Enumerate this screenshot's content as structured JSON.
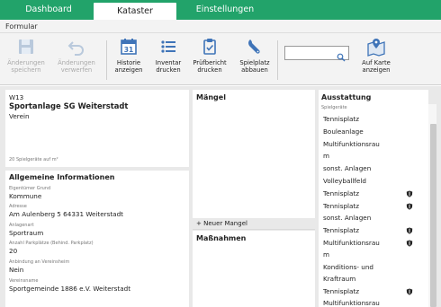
{
  "tabs": [
    {
      "label": "Dashboard",
      "active": false
    },
    {
      "label": "Kataster",
      "active": true
    },
    {
      "label": "Einstellungen",
      "active": false
    }
  ],
  "ribbon": {
    "group_label": "Formular",
    "buttons": {
      "save": {
        "line1": "Änderungen",
        "line2": "speichern",
        "icon": "save-icon",
        "enabled": false
      },
      "discard": {
        "line1": "Änderungen",
        "line2": "verwerfen",
        "icon": "undo-icon",
        "enabled": false
      },
      "history": {
        "line1": "Historie",
        "line2": "anzeigen",
        "icon": "calendar-icon",
        "enabled": true,
        "calendar_day": "31"
      },
      "inventory": {
        "line1": "Inventar",
        "line2": "drucken",
        "icon": "list-icon",
        "enabled": true
      },
      "report": {
        "line1": "Prüfbericht",
        "line2": "drucken",
        "icon": "clipboard-check-icon",
        "enabled": true
      },
      "dismantle": {
        "line1": "Spielplatz",
        "line2": "abbauen",
        "icon": "wrench-icon",
        "enabled": true
      },
      "map": {
        "line1": "Auf Karte",
        "line2": "anzeigen",
        "icon": "map-icon",
        "enabled": true
      }
    },
    "search": {
      "value": "",
      "icon": "search-icon"
    }
  },
  "site": {
    "code": "W13",
    "name": "Sportanlage SG Weiterstadt",
    "category": "Verein",
    "area_note": "20 Spielgeräte auf m²"
  },
  "general": {
    "heading": "Allgemeine Informationen",
    "fields": [
      {
        "label": "Eigentümer Grund",
        "value": "Kommune"
      },
      {
        "label": "Adresse",
        "value": "Am Aulenberg 5 64331 Weiterstadt"
      },
      {
        "label": "Anlagenart",
        "value": "Sportraum"
      },
      {
        "label": "Anzahl Parkplätze (Behind. Parkplatz)",
        "value": "20"
      },
      {
        "label": "Anbindung an Vereinsheim",
        "value": "Nein"
      },
      {
        "label": "Vereinsname",
        "value": "Sportgemeinde 1886 e.V. Weiterstadt"
      }
    ]
  },
  "maengel": {
    "heading": "Mängel",
    "add_label": "+ Neuer Mangel"
  },
  "massnahmen": {
    "heading": "Maßnahmen"
  },
  "ausstattung": {
    "heading": "Ausstattung",
    "section_label": "Spielgeräte",
    "items": [
      {
        "text": "Tennisplatz",
        "shield": false
      },
      {
        "text": "Bouleanlage",
        "shield": false
      },
      {
        "text": "Multifunktionsrau",
        "shield": false
      },
      {
        "text": "m",
        "shield": false
      },
      {
        "text": "sonst. Anlagen",
        "shield": false
      },
      {
        "text": "Volleyballfeld",
        "shield": false
      },
      {
        "text": "Tennisplatz",
        "shield": true
      },
      {
        "text": "Tennisplatz",
        "shield": true
      },
      {
        "text": "sonst. Anlagen",
        "shield": false
      },
      {
        "text": "Tennisplatz",
        "shield": true
      },
      {
        "text": "Multifunktionsrau",
        "shield": true
      },
      {
        "text": "m",
        "shield": false
      },
      {
        "text": "Konditions- und",
        "shield": false
      },
      {
        "text": "Kraftraum",
        "shield": false
      },
      {
        "text": "Tennisplatz",
        "shield": true
      },
      {
        "text": "Multifunktionsrau",
        "shield": false
      }
    ]
  },
  "colors": {
    "accent": "#22a36a",
    "icon_blue": "#3f74b8"
  }
}
